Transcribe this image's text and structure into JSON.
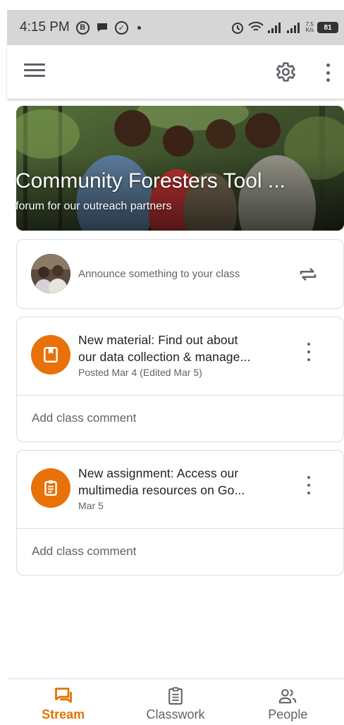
{
  "status_bar": {
    "time": "4:15 PM",
    "left_icons": [
      "b-badge-icon",
      "chat-bubble-icon",
      "whatsapp-icon",
      "dot-icon"
    ],
    "net_speed_value": "7.5",
    "net_speed_unit": "K/s",
    "battery": "81"
  },
  "app_bar": {
    "icons": [
      "menu-icon",
      "gear-icon",
      "more-vert-icon"
    ]
  },
  "banner": {
    "title": "Community Foresters Tool ...",
    "subtitle": "forum for our outreach partners"
  },
  "announce": {
    "placeholder": "Announce something to your class"
  },
  "posts": [
    {
      "title_line1": "New material: Find out about",
      "title_line2": "our data collection & manage...",
      "meta": "Posted Mar 4 (Edited Mar 5)",
      "icon": "material-book-icon",
      "comment_label": "Add class comment"
    },
    {
      "title_line1": "New assignment: Access our",
      "title_line2": "multimedia resources on Go...",
      "meta": "Mar 5",
      "icon": "assignment-clipboard-icon",
      "comment_label": "Add class comment"
    }
  ],
  "bottom_nav": {
    "items": [
      {
        "label": "Stream",
        "active": true
      },
      {
        "label": "Classwork",
        "active": false
      },
      {
        "label": "People",
        "active": false
      }
    ]
  },
  "colors": {
    "accent": "#e8710a",
    "active_nav": "#e37400",
    "status_bar": "#d6d6d6"
  }
}
